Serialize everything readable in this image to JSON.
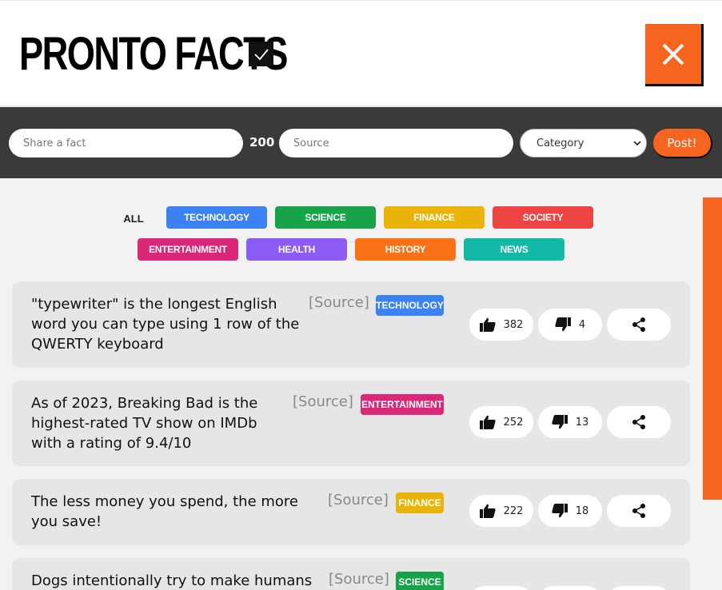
{
  "header": {
    "title": "PRONTO FACTS"
  },
  "postbar": {
    "fact_placeholder": "Share a fact",
    "char_count": "200",
    "source_placeholder": "Source",
    "category_selected": "Category",
    "post_label": "Post!"
  },
  "filters": {
    "all_label": "ALL",
    "categories": [
      {
        "label": "TECHNOLOGY",
        "color": "#3b82f6"
      },
      {
        "label": "SCIENCE",
        "color": "#16a34a"
      },
      {
        "label": "FINANCE",
        "color": "#eab308"
      },
      {
        "label": "SOCIETY",
        "color": "#ef4444"
      },
      {
        "label": "ENTERTAINMENT",
        "color": "#db2777"
      },
      {
        "label": "HEALTH",
        "color": "#8b5cf6"
      },
      {
        "label": "HISTORY",
        "color": "#f97316"
      },
      {
        "label": "NEWS",
        "color": "#14b8a6"
      }
    ]
  },
  "facts": [
    {
      "text": "\"typewriter\" is the longest English word you can type using 1 row of the QWERTY keyboard",
      "source": "[Source]",
      "category": "TECHNOLOGY",
      "category_color": "#3b82f6",
      "likes": "382",
      "dislikes": "4"
    },
    {
      "text": "As of 2023, Breaking Bad is the highest-rated TV show on IMDb with a rating of 9.4/10",
      "source": "[Source]",
      "category": "ENTERTAINMENT",
      "category_color": "#db2777",
      "likes": "252",
      "dislikes": "13"
    },
    {
      "text": "The less money you spend, the more you save!",
      "source": "[Source]",
      "category": "FINANCE",
      "category_color": "#eab308",
      "likes": "222",
      "dislikes": "18"
    },
    {
      "text": "Dogs intentionally try to make humans",
      "source": "[Source]",
      "category": "SCIENCE",
      "category_color": "#16a34a",
      "likes": "",
      "dislikes": ""
    }
  ],
  "colors": {
    "accent": "#f7641d",
    "postbar_bg": "#3a3a3a"
  },
  "icons": {
    "check": "check-icon",
    "close": "close-icon",
    "like": "thumbs-up-icon",
    "dislike": "thumbs-down-icon",
    "share": "share-icon"
  }
}
